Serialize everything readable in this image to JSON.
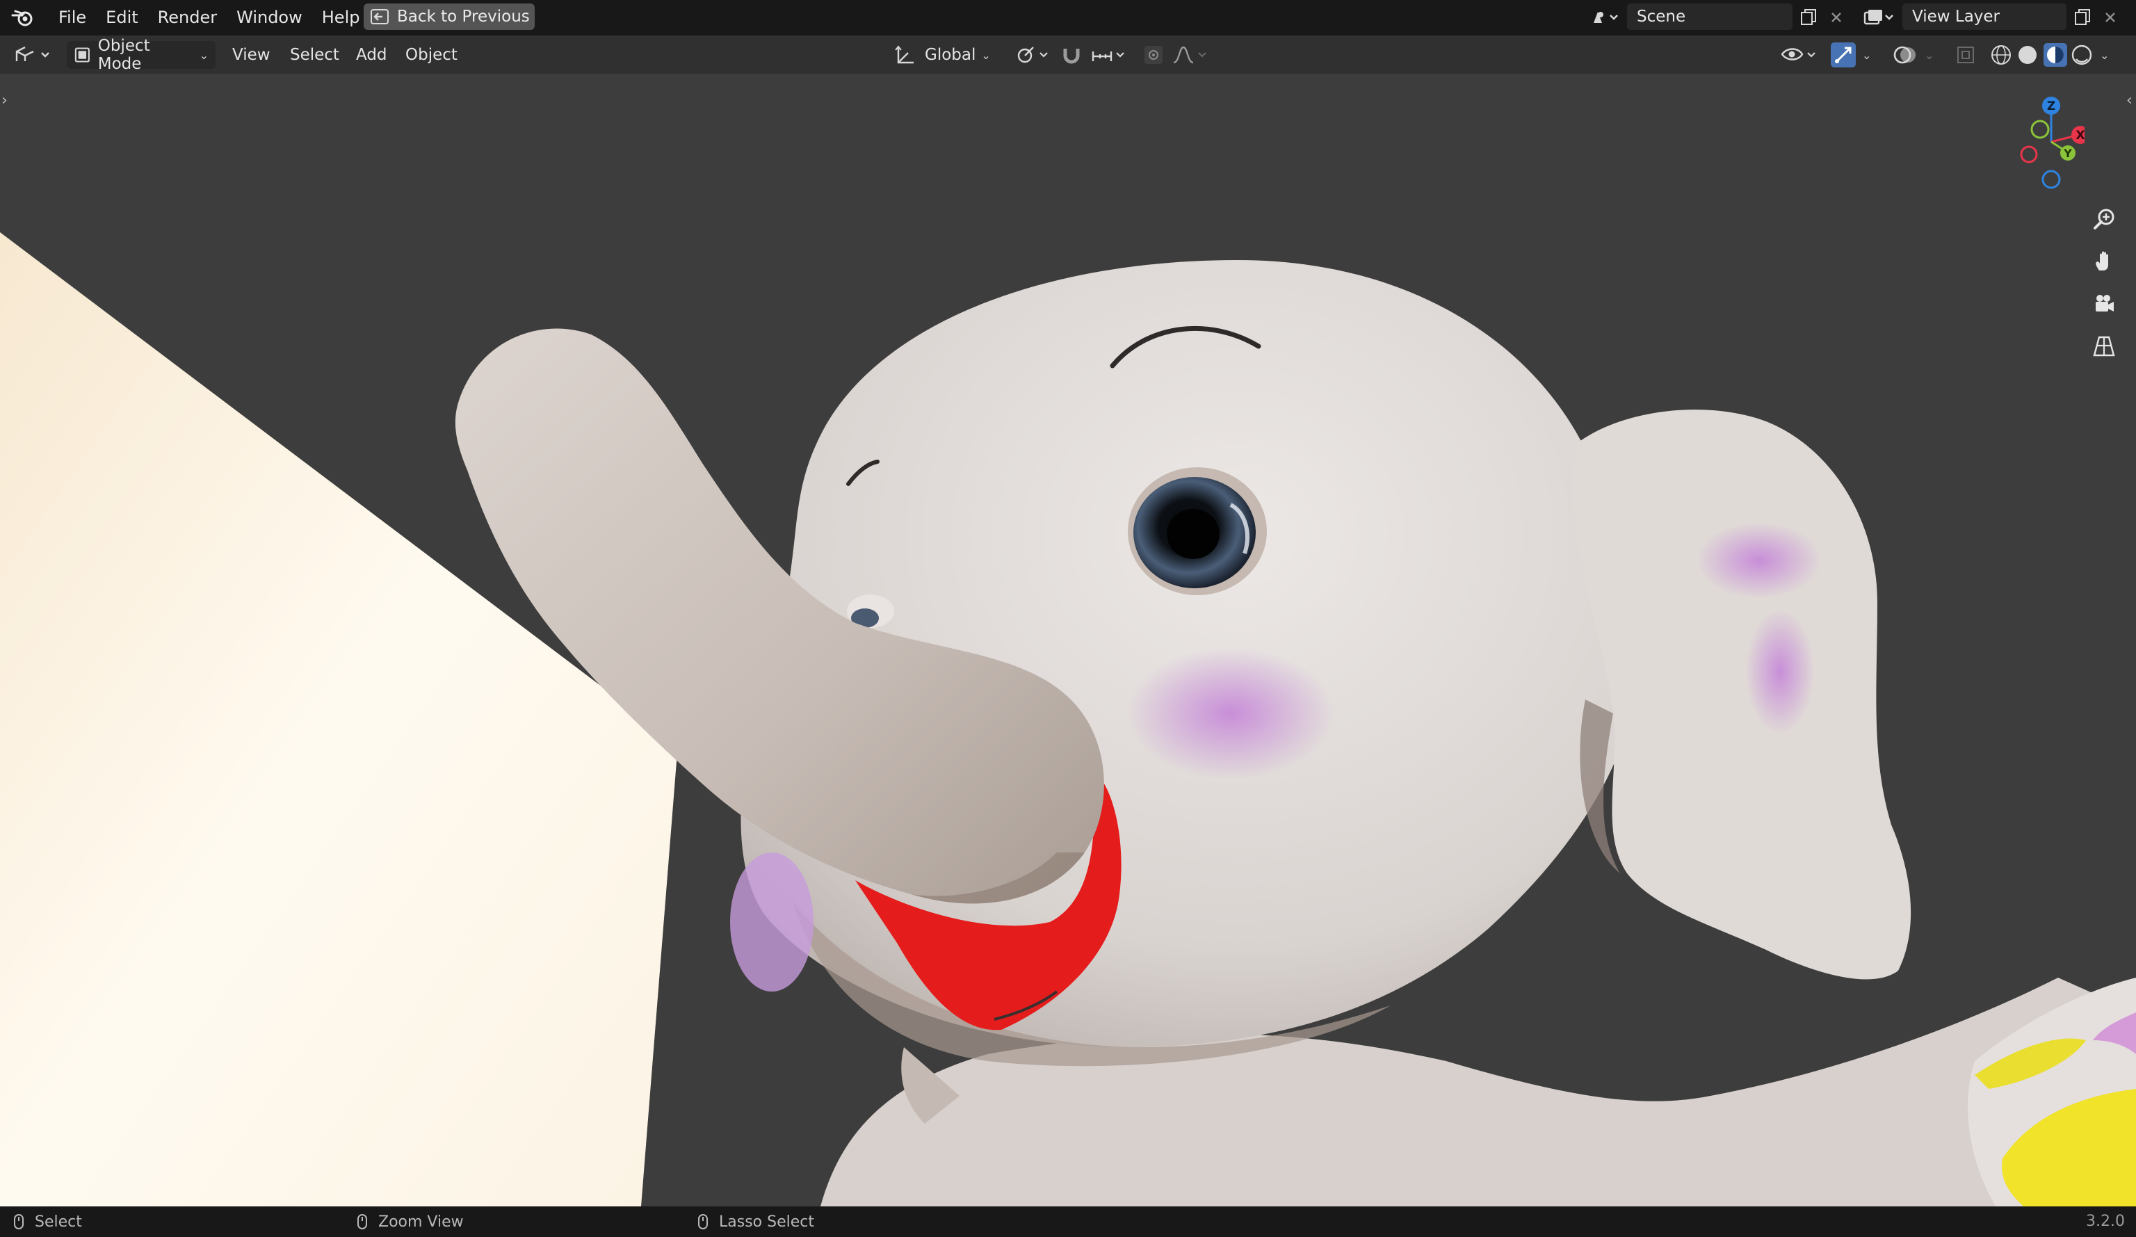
{
  "topbar": {
    "menu": [
      "File",
      "Edit",
      "Render",
      "Window",
      "Help"
    ],
    "back_button": "Back to Previous",
    "scene": "Scene",
    "view_layer": "View Layer"
  },
  "header": {
    "mode": "Object Mode",
    "menus": [
      "View",
      "Select",
      "Add",
      "Object"
    ],
    "orientation": "Global"
  },
  "gizmo": {
    "z": "Z",
    "x": "X",
    "y": "Y"
  },
  "statusbar": {
    "select": "Select",
    "zoom": "Zoom View",
    "lasso": "Lasso Select",
    "version": "3.2.0"
  },
  "colors": {
    "accent": "#4772b3",
    "axis_x": "#e8354a",
    "axis_y": "#8bc43a",
    "axis_z": "#2f83e0"
  }
}
